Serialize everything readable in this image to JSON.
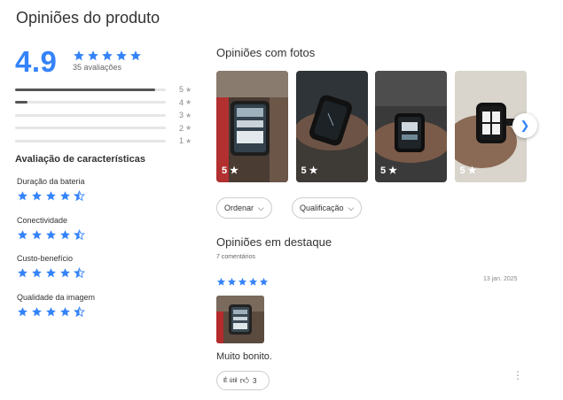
{
  "page_title": "Opiniões do produto",
  "summary": {
    "rating": "4.9",
    "count_text": "35 avaliações",
    "stars": 5
  },
  "distribution": [
    {
      "label": "5",
      "fraction": 0.93
    },
    {
      "label": "4",
      "fraction": 0.08
    },
    {
      "label": "3",
      "fraction": 0
    },
    {
      "label": "2",
      "fraction": 0
    },
    {
      "label": "1",
      "fraction": 0
    }
  ],
  "characteristics": {
    "title": "Avaliação de características",
    "items": [
      {
        "label": "Duração da bateria",
        "rating": 4.5
      },
      {
        "label": "Conectividade",
        "rating": 4.5
      },
      {
        "label": "Custo-benefício",
        "rating": 4.5
      },
      {
        "label": "Qualidade da imagem",
        "rating": 4.5
      }
    ]
  },
  "photos": {
    "title": "Opiniões com fotos",
    "items": [
      {
        "rating": "5 ★"
      },
      {
        "rating": "5 ★"
      },
      {
        "rating": "5 ★"
      },
      {
        "rating": "5 ★"
      }
    ],
    "next_icon": "chevron-right-icon"
  },
  "filters": {
    "order_label": "Ordenar",
    "rating_label": "Qualificação"
  },
  "featured": {
    "title": "Opiniões em destaque",
    "comments": "7 comentários",
    "review": {
      "stars": 5,
      "date": "13 jan. 2025",
      "text": "Muito bonito.",
      "useful_label": "É útil",
      "useful_count": "3"
    }
  },
  "colors": {
    "accent": "#3483fa",
    "bar": "#555555",
    "track": "#e6e6e6"
  }
}
